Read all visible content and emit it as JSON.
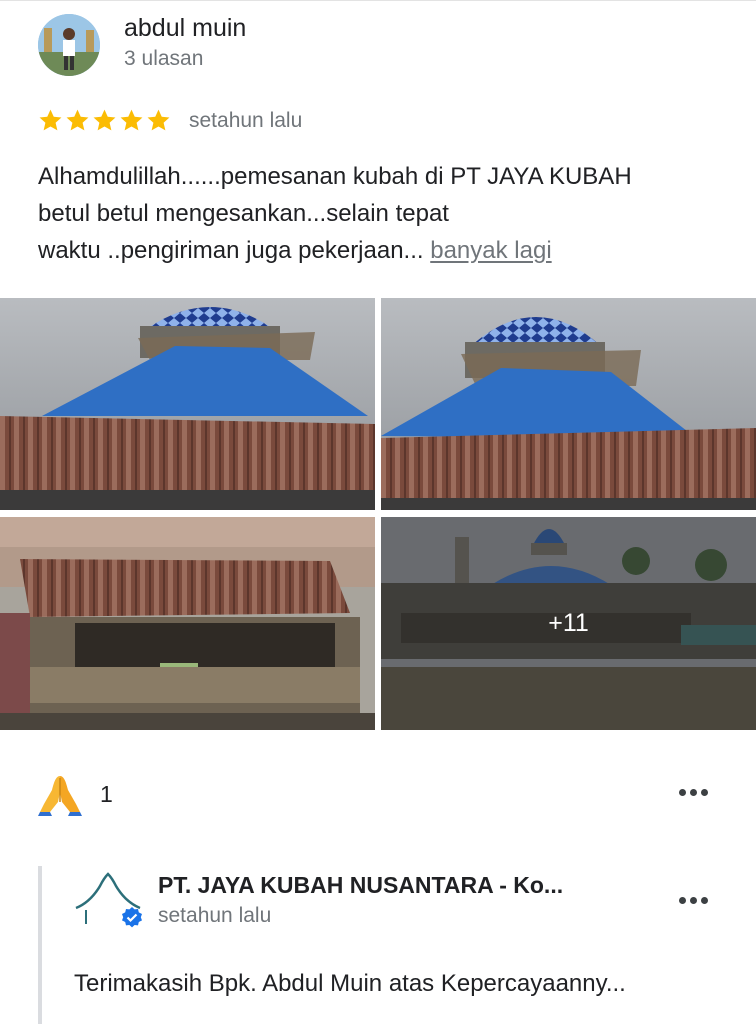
{
  "review": {
    "author_name": "abdul muin",
    "author_sub": "3 ulasan",
    "rating": 5,
    "time": "setahun lalu",
    "text_lines": [
      "Alhamdulillah......pemesanan kubah di PT JAYA KUBAH",
      "betul betul mengesankan...selain tepat",
      "waktu ..pengiriman juga pekerjaan... "
    ],
    "more_label": "banyak lagi"
  },
  "photos": {
    "more_count": "+11"
  },
  "reaction": {
    "count": "1",
    "icon": "folded-hands-emoji"
  },
  "owner_reply": {
    "name": "PT. JAYA KUBAH NUSANTARA - Ko...",
    "time": "setahun lalu",
    "text": "Terimakasih Bpk. Abdul Muin atas Kepercayaanny..."
  },
  "colors": {
    "star": "#fbbc04",
    "muted_text": "#70757a",
    "verified": "#1a73e8",
    "dome_blue": "#2f6fc4"
  }
}
